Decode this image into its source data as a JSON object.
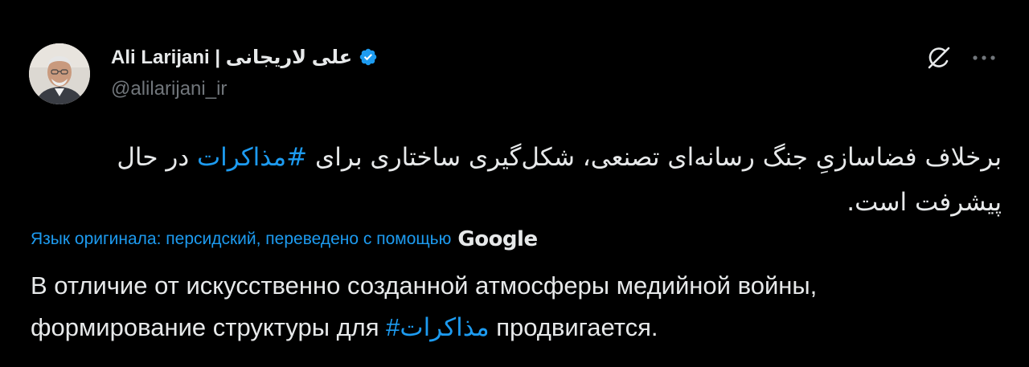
{
  "author": {
    "display_name": "Ali Larijani | علی لاریجانی",
    "handle": "@alilarijani_ir",
    "verified": true
  },
  "tweet": {
    "original_before": "برخلاف فضاسازیِ جنگ رسانه‌ای تصنعی، شکل‌گیری ساختاری برای ",
    "original_hashtag": "#مذاکرات",
    "original_after": " در حال پیشرفت است.",
    "translation_note": "Язык оригинала: персидский, переведено с помощью",
    "translation_provider": "Google",
    "translated_before": "В отличие от искусственно созданной атмосферы медийной войны, формирование структуры для ",
    "translated_hashtag": "#مذاکرات",
    "translated_after": " продвигается."
  },
  "icons": {
    "grok": "grok-icon",
    "more": "more-options-icon",
    "verified": "verified-badge-icon"
  },
  "colors": {
    "background": "#000000",
    "text": "#e7e9ea",
    "secondary": "#71767b",
    "accent": "#1d9bf0"
  }
}
